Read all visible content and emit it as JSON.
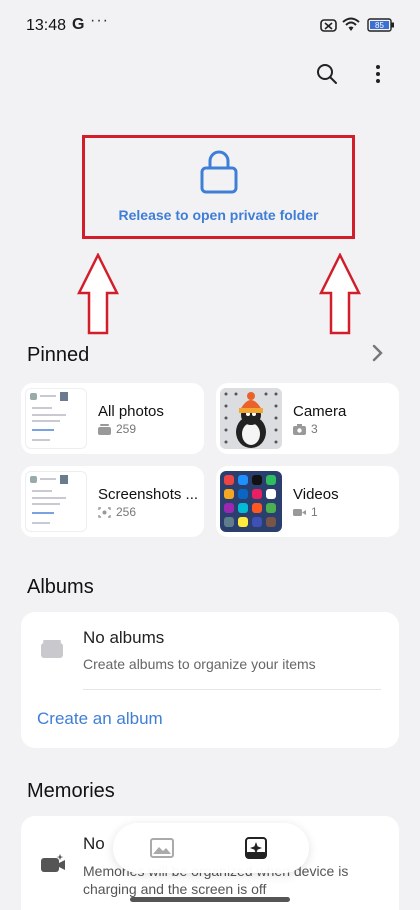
{
  "status_bar": {
    "time": "13:48",
    "g_label": "G",
    "overflow_dots": "···",
    "battery_level": "85"
  },
  "private_folder": {
    "label": "Release to open private folder",
    "highlight_color": "#d21e2a"
  },
  "pinned": {
    "title": "Pinned",
    "items": [
      {
        "title": "All photos",
        "count": "259",
        "meta_icon": "stack-icon"
      },
      {
        "title": "Camera",
        "count": "3",
        "meta_icon": "camera-icon"
      },
      {
        "title": "Screenshots ...",
        "count": "256",
        "meta_icon": "screenshot-icon"
      },
      {
        "title": "Videos",
        "count": "1",
        "meta_icon": "video-icon"
      }
    ]
  },
  "albums": {
    "title": "Albums",
    "empty_title": "No albums",
    "empty_subtitle": "Create albums to organize your items",
    "create_link": "Create an album"
  },
  "memories": {
    "title": "Memories",
    "empty_title": "No",
    "empty_subtitle": "Memories will be organized when device is charging and the screen is off"
  },
  "colors": {
    "accent": "#3f7ed6",
    "background": "#f2f2f4",
    "card": "#ffffff"
  }
}
